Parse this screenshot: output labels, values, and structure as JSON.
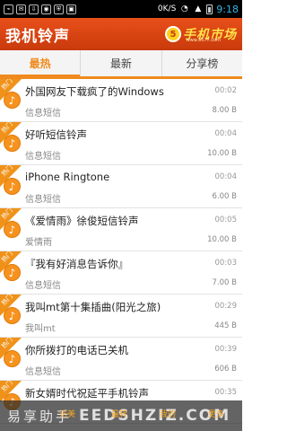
{
  "status_bar": {
    "network": "0K/S",
    "time": "9:18"
  },
  "header": {
    "title": "我机铃声",
    "logo_text": "手机市场",
    "logo_url": "www.5577.com"
  },
  "tabs": [
    {
      "label": "最热"
    },
    {
      "label": "最新"
    },
    {
      "label": "分享榜"
    }
  ],
  "hot_badge": "热门",
  "items": [
    {
      "title": "外国网友下载疯了的Windows",
      "duration": "00:02",
      "category": "信息短信",
      "size": "8.00 B"
    },
    {
      "title": "好听短信铃声",
      "duration": "00:04",
      "category": "信息短信",
      "size": "10.00 B"
    },
    {
      "title": "iPhone Ringtone",
      "duration": "00:04",
      "category": "信息短信",
      "size": "6.00 B"
    },
    {
      "title": "《爱情雨》徐俊短信铃声",
      "duration": "00:05",
      "category": "爱情雨",
      "size": "10.00 B"
    },
    {
      "title": "『我有好消息告诉你』",
      "duration": "00:03",
      "category": "信息短信",
      "size": "7.00 B"
    },
    {
      "title": "我叫mt第十集插曲(阳光之旅)",
      "duration": "00:29",
      "category": "我叫mt",
      "size": "445 B"
    },
    {
      "title": "你所拨打的电话已关机",
      "duration": "00:39",
      "category": "信息短信",
      "size": "606 B"
    },
    {
      "title": "新女婿时代祝延平手机铃声",
      "duration": "00:35",
      "category": "",
      "size": ""
    }
  ],
  "watermark": {
    "cn": "易享助手",
    "en": "EEDSHZIZ.COM",
    "sub1": "访美",
    "sub2": "最转",
    "sub3": "我的",
    "sub4": "更多"
  }
}
